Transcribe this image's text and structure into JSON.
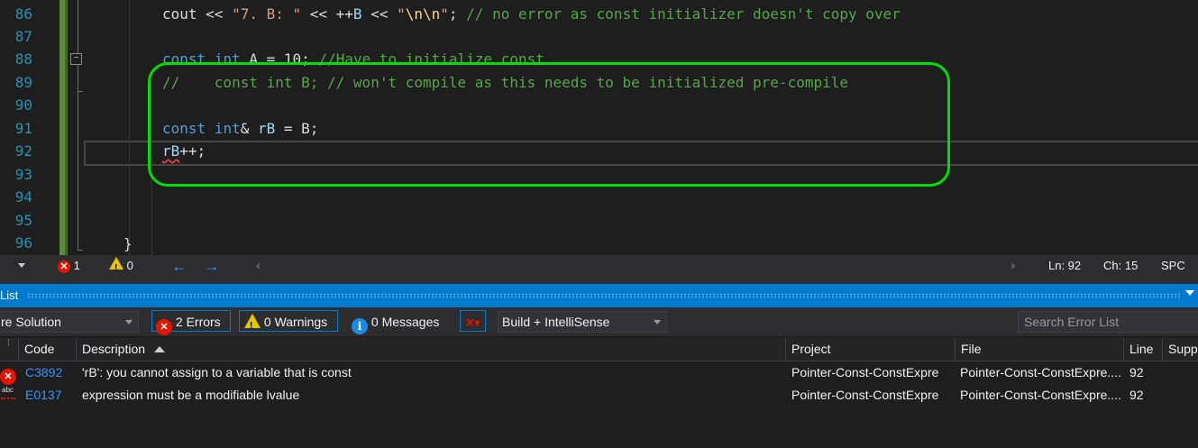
{
  "editor": {
    "lines": [
      {
        "no": "86"
      },
      {
        "no": "87"
      },
      {
        "no": "88"
      },
      {
        "no": "89"
      },
      {
        "no": "90"
      },
      {
        "no": "91"
      },
      {
        "no": "92"
      },
      {
        "no": "93"
      },
      {
        "no": "94"
      },
      {
        "no": "95"
      },
      {
        "no": "96"
      }
    ],
    "code": {
      "l86_a": "cout << ",
      "l86_str1": "\"7. B: \"",
      "l86_b": " << ++",
      "l86_var": "B",
      "l86_c": " << ",
      "l86_str2a": "\"",
      "l86_esc": "\\n\\n",
      "l86_str2b": "\"",
      "l86_d": "; ",
      "l86_cm": "// no error as const initializer doesn't copy over",
      "l88_kw1": "const",
      "l88_kw2": "int",
      "l88_a": " A = 10; ",
      "l88_cm": "//Have to initialize const",
      "l89_cm": "//    const int B; // won't compile as this needs to be initialized pre-compile",
      "l91_kw1": "const",
      "l91_kw2": "int",
      "l91_a": "& ",
      "l91_var": "rB",
      "l91_b": " = B;",
      "l92_var": "rB",
      "l92_a": "++;",
      "l96_brace": "}"
    }
  },
  "editor_status": {
    "errors": "1",
    "warnings": "0",
    "ln": "Ln: 92",
    "ch": "Ch: 15",
    "mode": "SPC"
  },
  "error_list": {
    "title": "List",
    "scope": "re Solution",
    "errors_btn": "2 Errors",
    "warnings_btn": "0 Warnings",
    "messages_btn": "0 Messages",
    "build_filter": "Build + IntelliSense",
    "search_placeholder": "Search Error List",
    "columns": {
      "code": "Code",
      "description": "Description",
      "project": "Project",
      "file": "File",
      "line": "Line",
      "suppression": "Supp"
    },
    "rows": [
      {
        "code": "C3892",
        "description": "'rB': you cannot assign to a variable that is const",
        "project": "Pointer-Const-ConstExpre",
        "file": "Pointer-Const-ConstExpre....",
        "line": "92",
        "icon": "error-icon"
      },
      {
        "code": "E0137",
        "description": "expression must be a modifiable lvalue",
        "project": "Pointer-Const-ConstExpre",
        "file": "Pointer-Const-ConstExpre....",
        "line": "92",
        "icon": "intellisense-error-icon"
      }
    ]
  },
  "colors": {
    "highlight": "#00e000",
    "accent": "#007acc",
    "error": "#e51400",
    "warning": "#e8c400"
  }
}
